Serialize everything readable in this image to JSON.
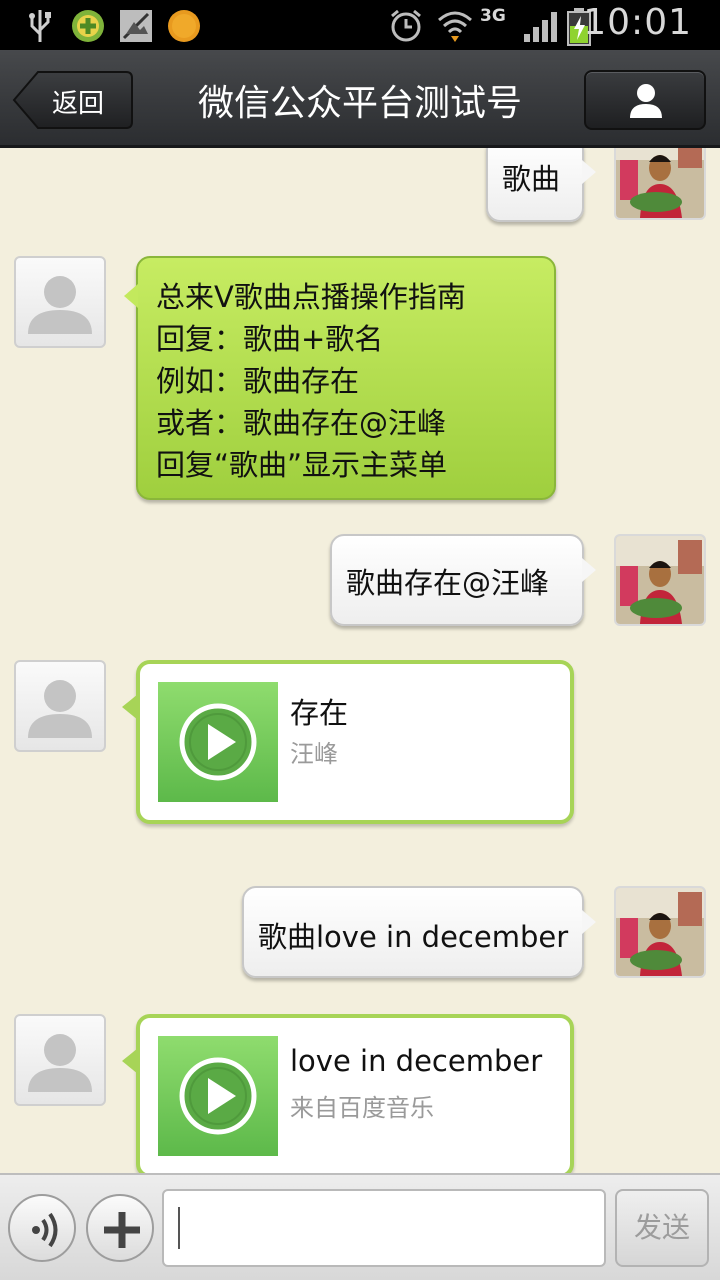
{
  "status_bar": {
    "time": "10:01",
    "network": "3G",
    "icons": [
      "usb-icon",
      "app-plus-icon",
      "no-sim-icon",
      "orange-app-icon",
      "alarm-icon",
      "wifi-icon",
      "signal-icon",
      "battery-charging-icon"
    ]
  },
  "header": {
    "back_label": "返回",
    "title": "微信公众平台测试号",
    "profile_icon": "person-icon"
  },
  "messages": [
    {
      "sender": "user",
      "type": "text",
      "text": "歌曲"
    },
    {
      "sender": "account",
      "type": "text",
      "lines": [
        "总来V歌曲点播操作指南",
        "回复：歌曲+歌名",
        "例如：歌曲存在",
        "或者：歌曲存在@汪峰",
        "回复“歌曲”显示主菜单"
      ]
    },
    {
      "sender": "user",
      "type": "text",
      "text": "歌曲存在@汪峰"
    },
    {
      "sender": "account",
      "type": "music",
      "title": "存在",
      "subtitle": "汪峰"
    },
    {
      "sender": "user",
      "type": "text",
      "text": "歌曲love in december"
    },
    {
      "sender": "account",
      "type": "music",
      "title": "love in december",
      "subtitle": "来自百度音乐"
    }
  ],
  "input_bar": {
    "voice_icon": "voice-icon",
    "plus_icon": "plus-icon",
    "input_value": "",
    "send_label": "发送"
  },
  "colors": {
    "chat_background": "#f3efdd",
    "header": "#3a3c3f",
    "green_bubble": "#b2df4f",
    "music_thumb": "#6cc657"
  }
}
